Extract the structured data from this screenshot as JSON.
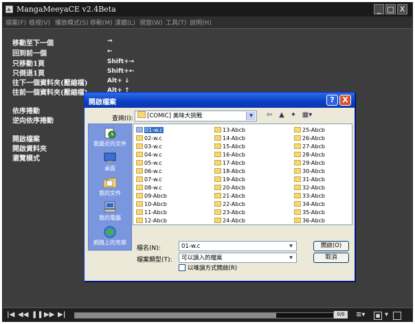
{
  "window": {
    "title": "MangaMeeyaCE v2.4Beta",
    "minimize": "_",
    "maximize": "□",
    "close": "X"
  },
  "menu": [
    "檔案(F)",
    "檢視(V)",
    "播放模式(S)",
    "移動(M)",
    "濾鏡(L)",
    "視窗(W)",
    "工具(T)",
    "說明(H)"
  ],
  "help": [
    {
      "key": "移動至下一個",
      "value": "→"
    },
    {
      "key": "回到前一個",
      "value": "←"
    },
    {
      "key": "只移動1頁",
      "value": "Shift+→"
    },
    {
      "key": "只倒退1頁",
      "value": "Shift+←"
    },
    {
      "key": "往下一個資料夾(壓縮檔)",
      "value": "Alt+ ↓"
    },
    {
      "key": "往前一個資料夾(壓縮檔)",
      "value": "Alt+ ↑"
    },
    {
      "key": "依序捲動",
      "value": ""
    },
    {
      "key": "逆向依序捲動",
      "value": ""
    },
    {
      "key": "開啟檔案",
      "value": ""
    },
    {
      "key": "開啟資料夾",
      "value": ""
    },
    {
      "key": "瀏覽模式",
      "value": ""
    }
  ],
  "dialog": {
    "title": "開啟檔案",
    "help_btn": "?",
    "close_btn": "X",
    "lookin_label": "查詢(I):",
    "lookin_value": "[COMIC] 美味大挑戰",
    "places": [
      "我最近的文件",
      "桌面",
      "我的文件",
      "我的電腦",
      "網路上的芳鄰"
    ],
    "files_col1": [
      "01-w.c",
      "02-w.c",
      "03-w.c",
      "04-w.c",
      "05-w.c",
      "06-w.c",
      "07-w.c",
      "08-w.c",
      "09-Abcb",
      "10-Abcb",
      "11-Abcb",
      "12-Abcb"
    ],
    "files_col2": [
      "13-Abcb",
      "14-Abcb",
      "15-Abcb",
      "16-Abcb",
      "17-Abcb",
      "18-Abcb",
      "19-Abcb",
      "20-Abcb",
      "21-Abcb",
      "22-Abcb",
      "23-Abcb",
      "24-Abcb"
    ],
    "files_col3": [
      "25-Abcb",
      "26-Abcb",
      "27-Abcb",
      "28-Abcb",
      "29-Abcb",
      "30-Abcb",
      "31-Abcb",
      "32-Abcb",
      "33-Abcb",
      "34-Abcb",
      "35-Abcb",
      "36-Abcb"
    ],
    "selected_file": "01-w.c",
    "filename_label": "檔名(N):",
    "filename_value": "01-w.c",
    "filetype_label": "檔案類型(T):",
    "filetype_value": "可以讀入的檔案",
    "readonly_label": "以唯讀方式開啟(R)",
    "open_button": "開啟(O)",
    "cancel_button": "取消"
  },
  "status": {
    "page_indicator": "0/0",
    "progress": 0.78
  },
  "colors": {
    "app_bg": "#3d3d3d",
    "dialog_bg": "#ece9d8",
    "xp_blue": "#0a3fc4",
    "selection": "#316ac5"
  }
}
